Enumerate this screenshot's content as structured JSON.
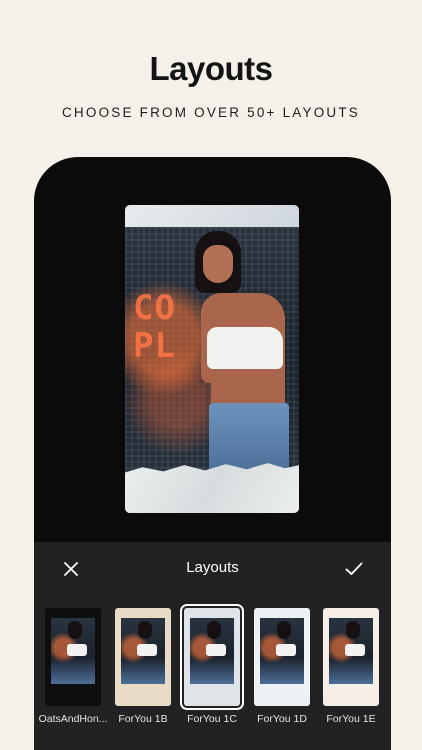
{
  "header": {
    "title": "Layouts",
    "subtitle": "CHOOSE FROM OVER 50+ LAYOUTS"
  },
  "preview": {
    "sign_text": "CO\nPL"
  },
  "panel": {
    "title": "Layouts",
    "close_icon": "close-icon",
    "confirm_icon": "check-icon"
  },
  "layouts": [
    {
      "label": "OatsAndHon...",
      "bg": "#0e0e10"
    },
    {
      "label": "ForYou 1B",
      "bg": "#e9dcc6"
    },
    {
      "label": "ForYou 1C",
      "bg": "#dfe4e8"
    },
    {
      "label": "ForYou 1D",
      "bg": "#eef1f3"
    },
    {
      "label": "ForYou 1E",
      "bg": "#f6efe8"
    }
  ],
  "selected_index": 2
}
